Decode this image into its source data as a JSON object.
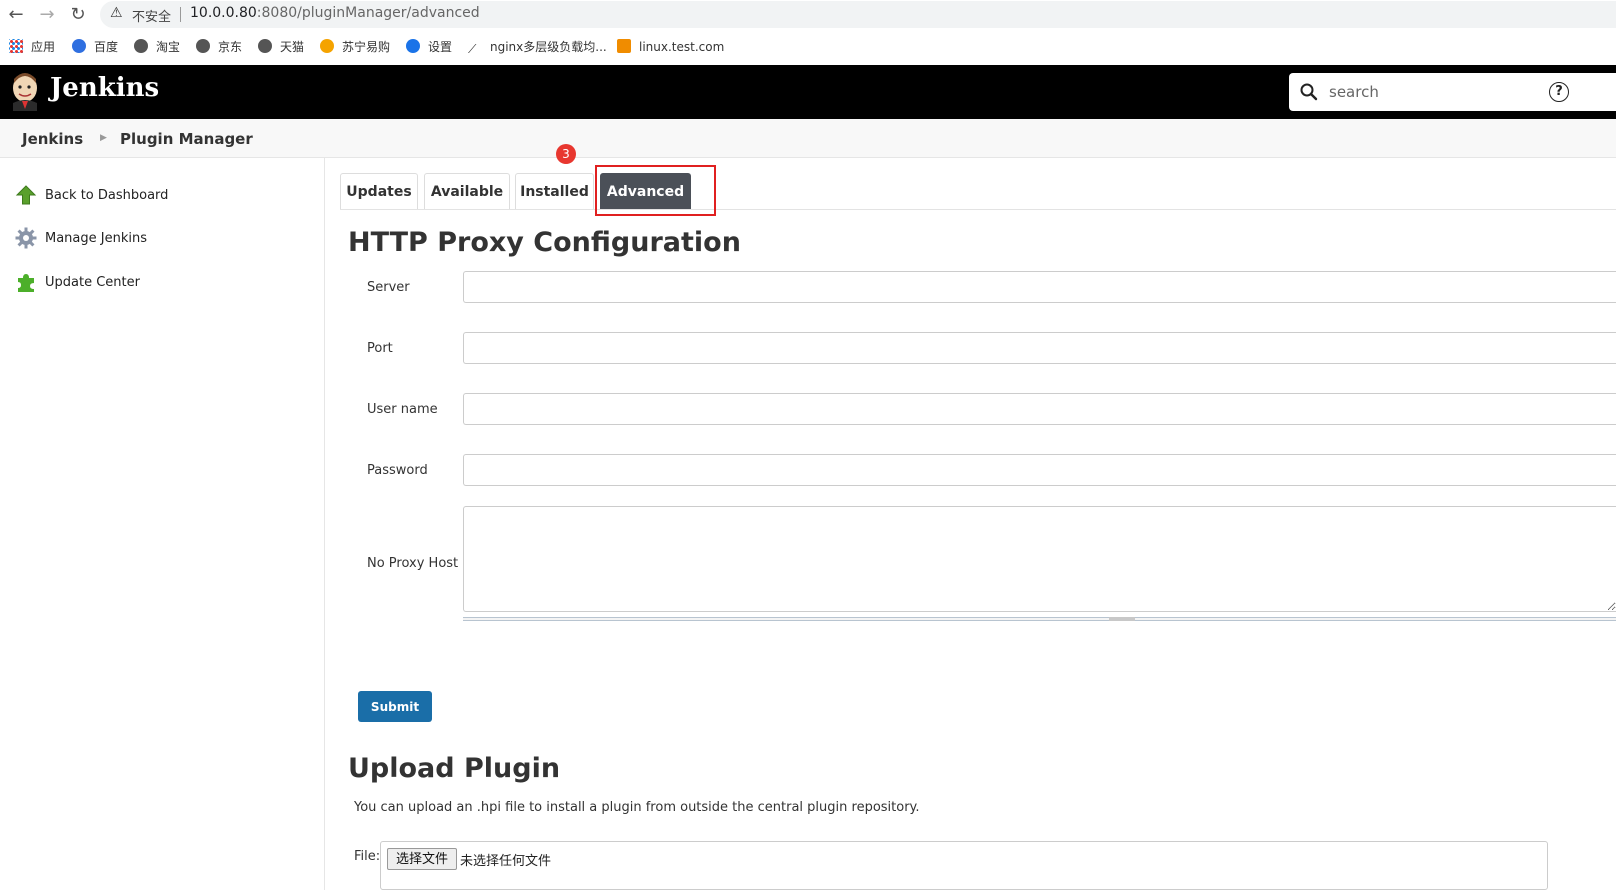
{
  "browser": {
    "back": "←",
    "forward": "→",
    "reload": "↻",
    "insecure_label": "不安全",
    "url_host": "10.0.0.80",
    "url_rest": ":8080/pluginManager/advanced"
  },
  "bookmarks": [
    {
      "label": "应用",
      "icon": "apps-grid-icon"
    },
    {
      "label": "百度",
      "icon": "baidu-paw-icon"
    },
    {
      "label": "淘宝",
      "icon": "globe-icon"
    },
    {
      "label": "京东",
      "icon": "globe-icon"
    },
    {
      "label": "天猫",
      "icon": "globe-icon"
    },
    {
      "label": "苏宁易购",
      "icon": "suning-icon"
    },
    {
      "label": "设置",
      "icon": "gear-icon"
    },
    {
      "label": "nginx多层级负载均...",
      "icon": "nginx-icon"
    },
    {
      "label": "linux.test.com",
      "icon": "bookmark-d-icon"
    }
  ],
  "header": {
    "brand": "Jenkins",
    "search_placeholder": "search",
    "help": "?"
  },
  "breadcrumb": {
    "root": "Jenkins",
    "current": "Plugin Manager"
  },
  "sidebar": {
    "items": [
      {
        "label": "Back to Dashboard",
        "icon": "up-arrow-icon"
      },
      {
        "label": "Manage Jenkins",
        "icon": "gear-icon"
      },
      {
        "label": "Update Center",
        "icon": "puzzle-icon"
      }
    ]
  },
  "tabs": {
    "items": [
      "Updates",
      "Available",
      "Installed",
      "Advanced"
    ],
    "active": "Advanced",
    "annotation_badge": "3"
  },
  "proxy": {
    "title": "HTTP Proxy Configuration",
    "fields": [
      {
        "label": "Server",
        "value": ""
      },
      {
        "label": "Port",
        "value": ""
      },
      {
        "label": "User name",
        "value": ""
      },
      {
        "label": "Password",
        "value": ""
      }
    ],
    "no_proxy_label": "No Proxy Host",
    "no_proxy_value": "",
    "submit": "Submit"
  },
  "upload": {
    "title": "Upload Plugin",
    "description": "You can upload an .hpi file to install a plugin from outside the central plugin repository.",
    "file_label": "File:",
    "choose_button": "选择文件",
    "no_file": "未选择任何文件"
  },
  "colors": {
    "header_bg": "#000000",
    "active_tab": "#4b5058",
    "submit_bg": "#1a6ea8",
    "annotation_red": "#e02020"
  }
}
